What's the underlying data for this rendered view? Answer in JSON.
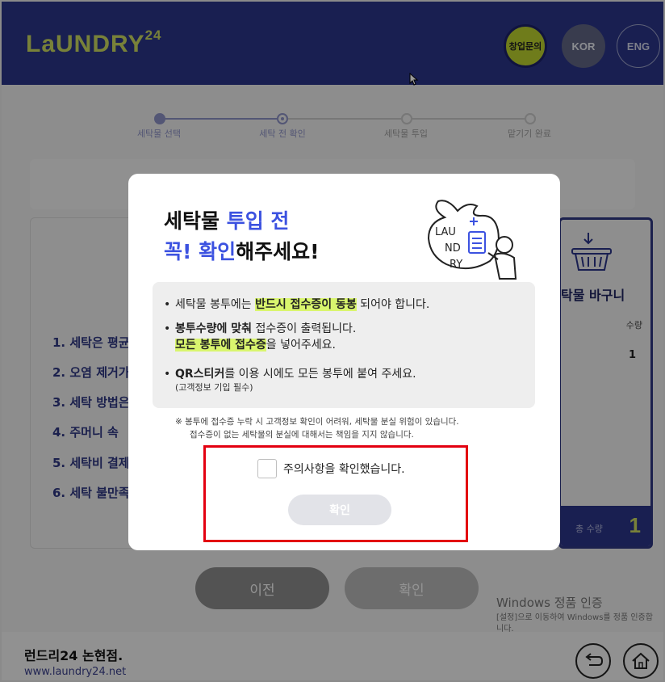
{
  "header": {
    "logo": "LaUNDRY",
    "logo_sup": "24",
    "startup_label": "창업문의",
    "kor_label": "KOR",
    "eng_label": "ENG"
  },
  "steps": [
    "세탁물 선택",
    "세탁 전 확인",
    "세탁물 투입",
    "맡기기 완료"
  ],
  "rules": [
    {
      "num": "1.",
      "text": "세탁은 평균"
    },
    {
      "num": "2.",
      "text": "오염 제거가"
    },
    {
      "num": "3.",
      "text": "세탁 방법은"
    },
    {
      "num": "4.",
      "text": "주머니 속 "
    },
    {
      "num": "5.",
      "text": "세탁비 결제"
    },
    {
      "num": "6.",
      "text": "세탁 불만족"
    }
  ],
  "basket": {
    "title": "탁물 바구니",
    "qty_header": "수량",
    "qty_value": "1",
    "total_label": "총 수량",
    "total_value": "1"
  },
  "buttons": {
    "prev": "이전",
    "ok": "확인"
  },
  "watermark": {
    "line1": "Windows 정품 인증",
    "line2": "[설정]으로 이동하여 Windows를 정품 인증합니다."
  },
  "footer": {
    "store": "런드리24 논현점.",
    "site": "www.laundry24.net"
  },
  "modal": {
    "title_a": "세탁물 ",
    "title_a_hl": "투입 전",
    "title_b_hl": "꼭! 확인",
    "title_b": "해주세요!",
    "illust_text": [
      "LAU",
      "ND",
      "RY"
    ],
    "notice1_pre": "세탁물 봉투에는 ",
    "notice1_mark": "반드시 접수증이 동봉",
    "notice1_post": " 되어야 합니다.",
    "notice2_bold": "봉투수량에 맞춰",
    "notice2_post": " 접수증이 출력됩니다.",
    "notice2_mark": "모든 봉투에 접수증",
    "notice2_post2": "을 넣어주세요.",
    "notice3_bold": "QR스티커",
    "notice3_post": "를 이용 시에도 모든 봉투에 붙여 주세요.",
    "notice3_sub": "(고객정보 기입 필수)",
    "warn1": "※ 봉투에 접수증 누락 시 고객정보 확인이 어려워, 세탁물 분실 위험이 있습니다.",
    "warn2": "접수증이 없는 세탁물의 분실에 대해서는 책임을 지지 않습니다.",
    "checkbox_label": "주의사항을 확인했습니다.",
    "confirm_label": "확인"
  }
}
